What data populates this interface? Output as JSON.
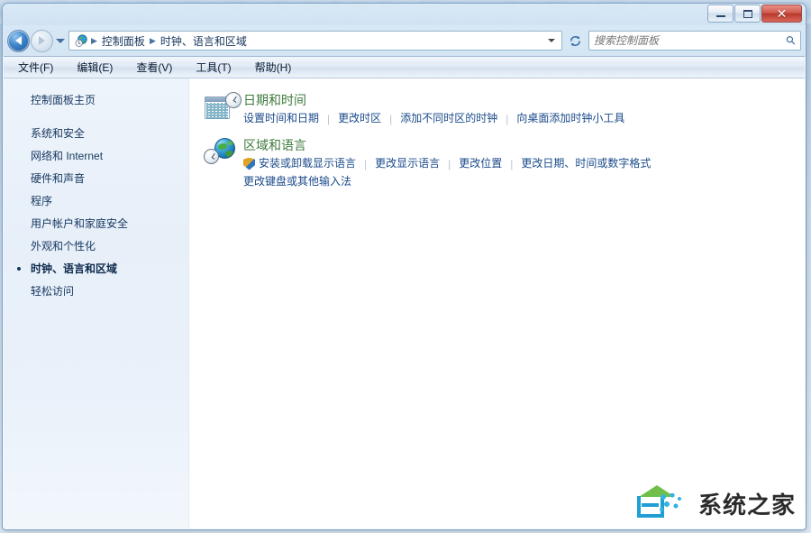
{
  "window": {
    "controls": {
      "minimize_label": "最小化",
      "maximize_label": "最大化",
      "close_label": "✕"
    }
  },
  "navbar": {
    "back_label": "后退",
    "forward_label": "前进",
    "recent_pages_label": "最近浏览的位置",
    "refresh_label": "刷新",
    "breadcrumbs": [
      {
        "label": "控制面板"
      },
      {
        "label": "时钟、语言和区域"
      }
    ],
    "separator": "▶"
  },
  "search": {
    "placeholder": "搜索控制面板",
    "value": "",
    "icon": "search-icon"
  },
  "menubar": {
    "items": [
      {
        "label": "文件(F)"
      },
      {
        "label": "编辑(E)"
      },
      {
        "label": "查看(V)"
      },
      {
        "label": "工具(T)"
      },
      {
        "label": "帮助(H)"
      }
    ]
  },
  "sidebar": {
    "home_label": "控制面板主页",
    "items": [
      {
        "label": "系统和安全",
        "active": false
      },
      {
        "label": "网络和 Internet",
        "active": false
      },
      {
        "label": "硬件和声音",
        "active": false
      },
      {
        "label": "程序",
        "active": false
      },
      {
        "label": "用户帐户和家庭安全",
        "active": false
      },
      {
        "label": "外观和个性化",
        "active": false
      },
      {
        "label": "时钟、语言和区域",
        "active": true
      },
      {
        "label": "轻松访问",
        "active": false
      }
    ]
  },
  "content": {
    "categories": [
      {
        "title": "日期和时间",
        "icon": "calendar-clock-icon",
        "rows": [
          {
            "links": [
              {
                "label": "设置时间和日期",
                "shield": false
              },
              {
                "label": "更改时区",
                "shield": false
              },
              {
                "label": "添加不同时区的时钟",
                "shield": false
              },
              {
                "label": "向桌面添加时钟小工具",
                "shield": false
              }
            ]
          }
        ]
      },
      {
        "title": "区域和语言",
        "icon": "globe-clock-icon",
        "rows": [
          {
            "links": [
              {
                "label": "安装或卸载显示语言",
                "shield": true
              },
              {
                "label": "更改显示语言",
                "shield": false
              },
              {
                "label": "更改位置",
                "shield": false
              },
              {
                "label": "更改日期、时间或数字格式",
                "shield": false
              }
            ]
          },
          {
            "links": [
              {
                "label": "更改键盘或其他输入法",
                "shield": false
              }
            ]
          }
        ]
      }
    ],
    "link_separator": "|"
  },
  "watermark": {
    "text": "系统之家",
    "logo": "house-logo"
  },
  "colors": {
    "category_title": "#3e7a3c",
    "link": "#1a4a8a",
    "sidebar_text": "#16375f",
    "close_button": "#b8382c"
  }
}
